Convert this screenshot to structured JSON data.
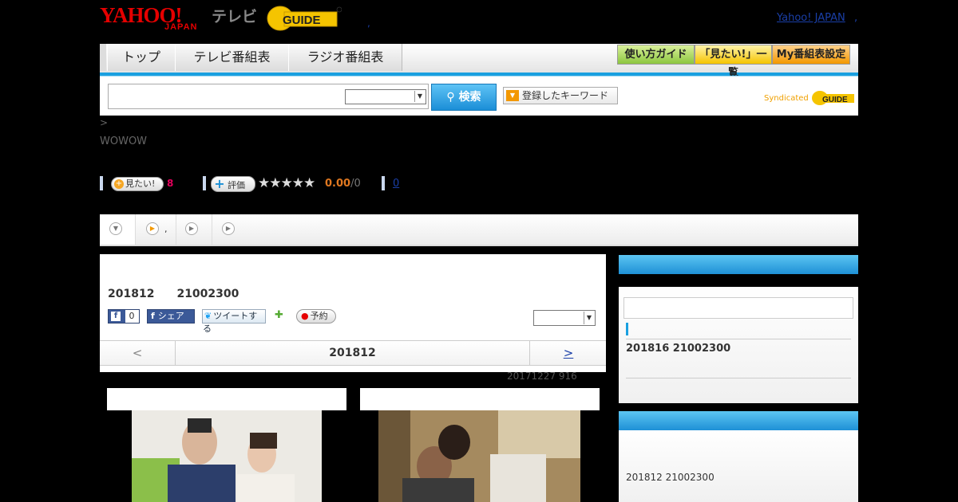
{
  "header": {
    "logo_yahoo": "YAHOO!",
    "logo_japan": "JAPAN",
    "logo_tv": "テレビ",
    "gguide_logo": "GUIDE",
    "comma": ",",
    "yahoo_japan_link": "Yahoo! JAPAN",
    "yahoo_japan_comma": ","
  },
  "nav": {
    "tabs": [
      "トップ",
      "テレビ番組表",
      "ラジオ番組表"
    ],
    "right_buttons": [
      "使い方ガイド",
      "「見たい!」一覧",
      "My番組表設定"
    ]
  },
  "search": {
    "input_value": "",
    "select_value": "",
    "button_label": "検索",
    "keyword_button": "登録したキーワード",
    "syndicated": "Syndicated"
  },
  "breadcrumb": ">",
  "channel": "WOWOW",
  "ratings": {
    "mitai_label": "見たい!",
    "mitai_count": "8",
    "hyoka_label": "評価",
    "stars": 0,
    "score": "0.00",
    "score_total": "/0",
    "review_count": "0"
  },
  "tabs_row": {
    "tab2_suffix": ","
  },
  "main": {
    "program_title": "201812　　21002300",
    "fb_count": "0",
    "share_label": "シェア",
    "tweet_label": "ツイートする",
    "reserve_label": "予約",
    "dropdown_value": "",
    "pager_prev": "<",
    "pager_center": "201812",
    "pager_next": ">",
    "updated": "20171227  916"
  },
  "sidebar": {
    "box1_item": "201816  21002300",
    "box2_item": "201812  21002300"
  },
  "colors": {
    "accent_blue": "#1aa0e0",
    "mitai_pink": "#e6005c",
    "score_orange": "#e07820",
    "link_blue": "#1a3fa8"
  }
}
